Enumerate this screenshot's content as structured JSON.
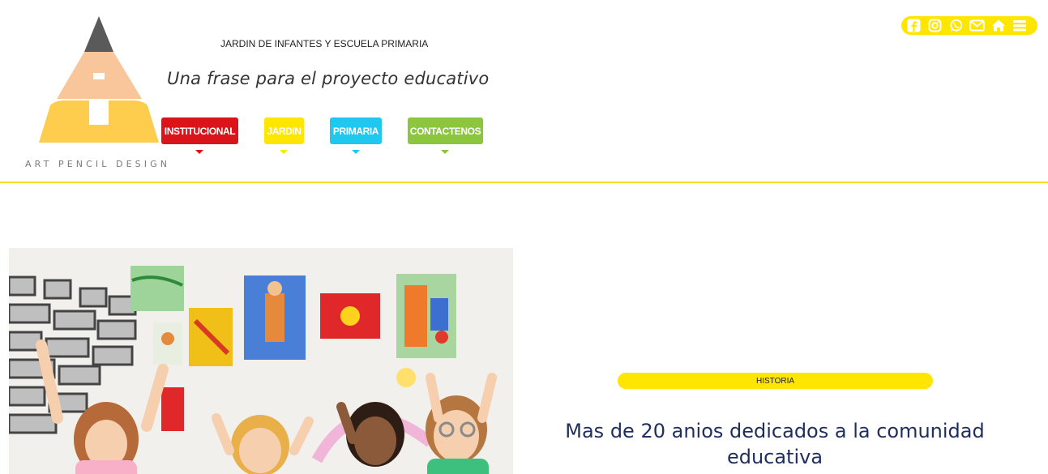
{
  "brand": {
    "logo_text": "ART PENCIL DESIGN",
    "school_title": "JARDIN DE INFANTES Y ESCUELA PRIMARIA",
    "tagline": "Una frase para el proyecto educativo"
  },
  "nav": [
    {
      "label": "INSTITUCIONAL",
      "color": "#d9151b"
    },
    {
      "label": "JARDIN",
      "color": "#ffe600"
    },
    {
      "label": "PRIMARIA",
      "color": "#1fc8ee"
    },
    {
      "label": "CONTACTENOS",
      "color": "#8cc63f"
    }
  ],
  "social": {
    "bar_color": "#ffe600",
    "icons": [
      "facebook-icon",
      "instagram-icon",
      "whatsapp-icon",
      "mail-icon",
      "home-icon",
      "menu-icon"
    ]
  },
  "hero": {
    "image": "children-raising-hands-photo",
    "section_label": "HISTORIA",
    "headline": "Mas de 20 anios dedicados a la comunidad educativa"
  },
  "colors": {
    "accent": "#ffe600",
    "headline": "#1f2e5c",
    "divider": "#f5e027"
  }
}
